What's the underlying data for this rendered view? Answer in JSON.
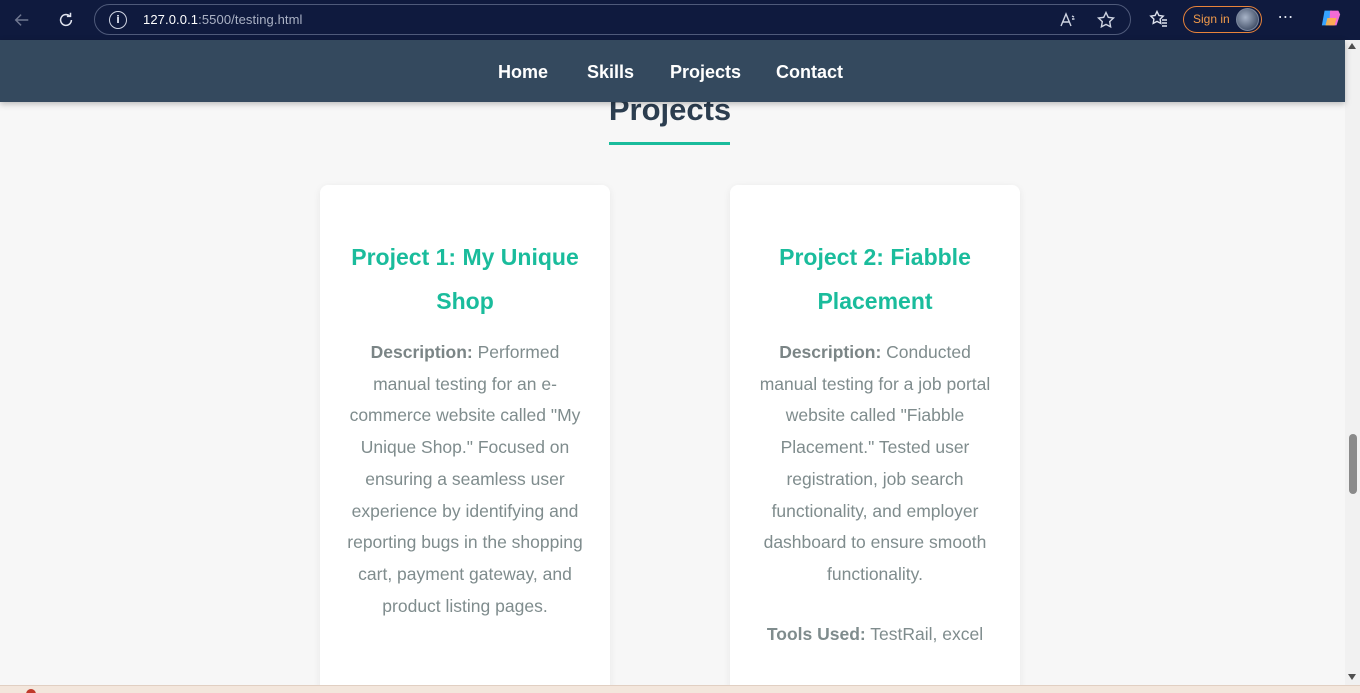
{
  "browser": {
    "url_host": "127.0.0.1",
    "url_path": ":5500/testing.html",
    "signin_label": "Sign in"
  },
  "nav": {
    "items": [
      "Home",
      "Skills",
      "Projects",
      "Contact"
    ]
  },
  "section": {
    "title": "Projects"
  },
  "projects": [
    {
      "title": "Project 1: My Unique Shop",
      "desc_label": "Description:",
      "desc_text": " Performed manual testing for an e-commerce website called \"My Unique Shop.\" Focused on ensuring a seamless user experience by identifying and reporting bugs in the shopping cart, payment gateway, and product listing pages.",
      "tools_label": "",
      "tools_text": ""
    },
    {
      "title": "Project 2: Fiabble Placement",
      "desc_label": "Description:",
      "desc_text": " Conducted manual testing for a job portal website called \"Fiabble Placement.\" Tested user registration, job search functionality, and employer dashboard to ensure smooth functionality.",
      "tools_label": "Tools Used:",
      "tools_text": " TestRail, excel"
    }
  ],
  "colors": {
    "accent": "#1abc9c",
    "nav_bg": "#34495e",
    "heading": "#2c3e50",
    "body_text": "#7f8c8d",
    "browser_bar": "#0f1a3e"
  }
}
